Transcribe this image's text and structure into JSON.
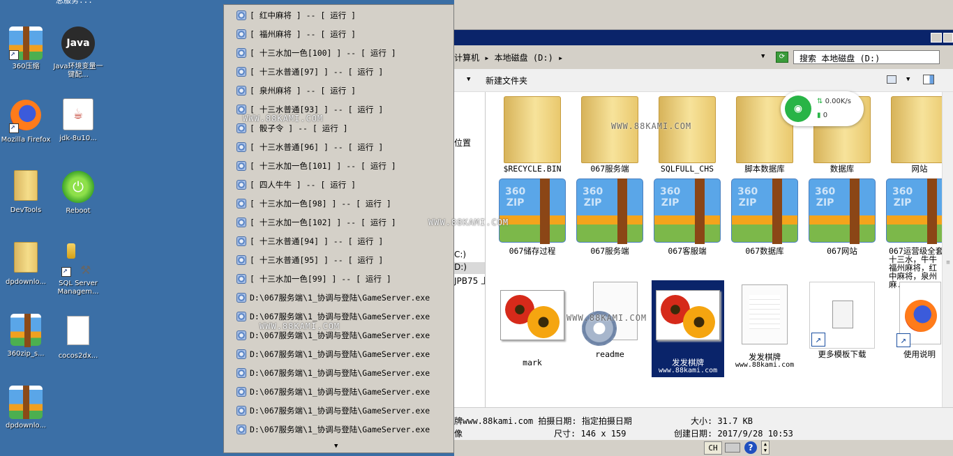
{
  "desktop": {
    "top_partial_text": "总服务...",
    "icons": [
      {
        "label": "360压缩"
      },
      {
        "label": "Java环境变量一键配..."
      },
      {
        "label": "Mozilla Firefox"
      },
      {
        "label": "jdk-8u10..."
      },
      {
        "label": "DevTools"
      },
      {
        "label": "Reboot"
      },
      {
        "label": "dpdownlo..."
      },
      {
        "label": "SQL Server Managem..."
      },
      {
        "label": "360zip_s..."
      },
      {
        "label": "cocos2dx..."
      },
      {
        "label": "dpdownlo..."
      }
    ],
    "java_logo_text": "Java",
    "jdk_glyph": "☕"
  },
  "popup_menu": {
    "items": [
      "[ 红中麻将 ] -- [ 运行 ]",
      "[ 福州麻将 ] -- [ 运行 ]",
      "[ 十三水加一色[100] ] -- [ 运行 ]",
      "[ 十三水普通[97] ] -- [ 运行 ]",
      "[ 泉州麻将 ] -- [ 运行 ]",
      "[ 十三水普通[93] ] -- [ 运行 ]",
      "[ 骰子令 ] -- [ 运行 ]",
      "[ 十三水普通[96] ] -- [ 运行 ]",
      "[ 十三水加一色[101] ] -- [ 运行 ]",
      "[ 四人牛牛 ] -- [ 运行 ]",
      "[ 十三水加一色[98] ] -- [ 运行 ]",
      "[ 十三水加一色[102] ] -- [ 运行 ]",
      "[ 十三水普通[94] ] -- [ 运行 ]",
      "[ 十三水普通[95] ] -- [ 运行 ]",
      "[ 十三水加一色[99] ] -- [ 运行 ]",
      "D:\\067服务端\\1_协调与登陆\\GameServer.exe",
      "D:\\067服务端\\1_协调与登陆\\GameServer.exe",
      "D:\\067服务端\\1_协调与登陆\\GameServer.exe",
      "D:\\067服务端\\1_协调与登陆\\GameServer.exe",
      "D:\\067服务端\\1_协调与登陆\\GameServer.exe",
      "D:\\067服务端\\1_协调与登陆\\GameServer.exe",
      "D:\\067服务端\\1_协调与登陆\\GameServer.exe",
      "D:\\067服务端\\1_协调与登陆\\GameServer.exe"
    ],
    "more_arrow": "▼"
  },
  "explorer": {
    "address": "计算机 ▸ 本地磁盘 (D:) ▸",
    "address_dropdown": "▼",
    "search_placeholder": "搜索 本地磁盘 (D:)",
    "toolbar": {
      "organize_arrow": "▼",
      "new_folder": "新建文件夹",
      "view_arrow": "▼"
    },
    "nav": {
      "item1": "位置",
      "item2": "C:)",
      "item3": "D:)",
      "item4": "JPB75 上"
    },
    "files_row1": [
      {
        "name": "$RECYCLE.BIN"
      },
      {
        "name": "067服务端"
      },
      {
        "name": "SQLFULL_CHS"
      },
      {
        "name": "脚本数据库"
      },
      {
        "name": "数据库"
      },
      {
        "name": "网站"
      }
    ],
    "files_row2": [
      {
        "name": "067储存过程"
      },
      {
        "name": "067服务端"
      },
      {
        "name": "067客服端"
      },
      {
        "name": "067数据库"
      },
      {
        "name": "067网站"
      },
      {
        "name": "067运营级全套十三水，牛牛福州麻将，红中麻将，泉州麻..."
      }
    ],
    "files_row3": [
      {
        "name": "mark",
        "sub": ""
      },
      {
        "name": "readme",
        "sub": ""
      },
      {
        "name": "发发棋牌",
        "sub": "www.88kami.com"
      },
      {
        "name": "发发棋牌",
        "sub": "www.88kami.com"
      },
      {
        "name": "更多模板下载",
        "sub": ""
      },
      {
        "name": "使用说明",
        "sub": ""
      }
    ],
    "details": {
      "name_line": "牌www.88kami.com 拍摄日期: 指定拍摄日期",
      "type_line": "像",
      "size_label": "大小: 31.7 KB",
      "dims_label": "尺寸: 146 x 159",
      "created_label": "创建日期: 2017/9/28 10:53"
    }
  },
  "net_widget": {
    "speed": "0.00K/s",
    "connections": "0",
    "up_arrow": "⇅",
    "conn_icon": "▮"
  },
  "tray": {
    "lang": "CH",
    "help": "?",
    "arrows": "▲\n▼"
  },
  "watermarks": {
    "text": "WWW.88KAMI.COM"
  }
}
